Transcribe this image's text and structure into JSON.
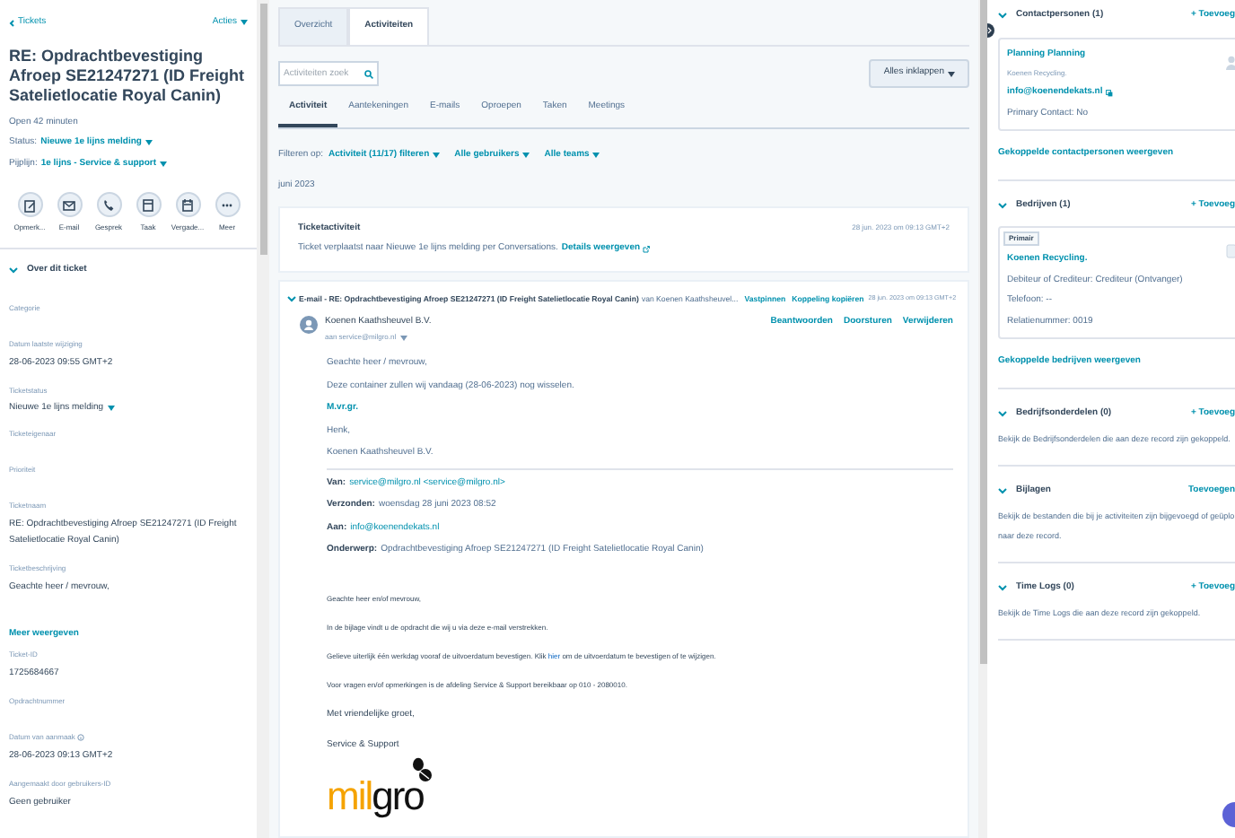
{
  "left": {
    "back_link": "Tickets",
    "actions_menu": "Acties",
    "title": "RE: Opdrachtbevestiging Afroep SE21247271 (ID Freight Satelietlocatie Royal Canin)",
    "open_time": "Open 42 minuten",
    "meta": [
      {
        "label": "Status:",
        "value": "Nieuwe 1e lijns melding"
      },
      {
        "label": "Pijplijn:",
        "value": "1e lijns - Service & support"
      }
    ],
    "quick_actions": [
      {
        "kind": "note",
        "label": "Opmerk..."
      },
      {
        "kind": "email",
        "label": "E-mail"
      },
      {
        "kind": "call",
        "label": "Gesprek"
      },
      {
        "kind": "task",
        "label": "Taak"
      },
      {
        "kind": "meeting",
        "label": "Vergade..."
      },
      {
        "kind": "more",
        "label": "Meer"
      }
    ],
    "section": {
      "title": "Over dit ticket",
      "expanded": true
    },
    "fields": [
      {
        "kind": "field",
        "label": "Categorie"
      },
      {
        "kind": "field",
        "label": "Datum laatste wijziging",
        "value": "28-06-2023 09:55 GMT+2"
      },
      {
        "kind": "dropdown",
        "label": "Ticketstatus",
        "value": "Nieuwe 1e lijns melding"
      },
      {
        "kind": "field",
        "label": "Ticketeigenaar"
      },
      {
        "kind": "field",
        "label": "Prioriteit"
      },
      {
        "kind": "field",
        "label": "Ticketnaam",
        "value": "RE: Opdrachtbevestiging Afroep SE21247271 (ID Freight Satelietlocatie Royal Canin)"
      },
      {
        "kind": "field",
        "label": "Ticketbeschrijving",
        "value": "Geachte heer / mevrouw,"
      },
      {
        "kind": "link",
        "label": "Meer weergeven"
      },
      {
        "kind": "field",
        "label": "Ticket-ID",
        "value": "1725684667"
      },
      {
        "kind": "field",
        "label": "Opdrachtnummer"
      },
      {
        "kind": "info",
        "label": "Datum van aanmaak",
        "value": "28-06-2023 09:13 GMT+2"
      },
      {
        "kind": "field",
        "label": "Aangemaakt door gebruikers-ID",
        "value": "Geen gebruiker"
      }
    ]
  },
  "middle": {
    "tabs": [
      {
        "label": "Overzicht",
        "selected": false
      },
      {
        "label": "Activiteiten",
        "selected": true
      }
    ],
    "search": {
      "placeholder": "Activiteiten zoek"
    },
    "collapse_button": "Alles inklappen",
    "subtabs": [
      {
        "label": "Activiteit",
        "selected": true
      },
      {
        "label": "Aantekeningen",
        "selected": false
      },
      {
        "label": "E-mails",
        "selected": false
      },
      {
        "label": "Oproepen",
        "selected": false
      },
      {
        "label": "Taken",
        "selected": false
      },
      {
        "label": "Meetings",
        "selected": false
      }
    ],
    "filter_label": "Filteren op:",
    "filters": [
      "Activiteit (11/17) filteren",
      "Alle gebruikers",
      "Alle teams"
    ],
    "month": "juni 2023",
    "ticket_activity": {
      "title": "Ticketactiviteit",
      "time": "28 jun. 2023 om 09:13 GMT+2",
      "text": "Ticket verplaatst naar Nieuwe 1e lijns melding per Conversations.",
      "link": "Details weergeven"
    },
    "email": {
      "expanded": true,
      "subject": "E-mail - RE: Opdrachtbevestiging Afroep SE21247271 (ID Freight Satelietlocatie Royal Canin)",
      "from": "van Koenen Kaathsheuvel...",
      "actions": [
        "Vastpinnen",
        "Koppeling kopiëren"
      ],
      "time": "28 jun. 2023 om 09:13 GMT+2",
      "sender": "Koenen Kaathsheuvel B.V.",
      "recipient": "aan service@milgro.nl",
      "reply_actions": [
        "Beantwoorden",
        "Doorsturen",
        "Verwijderen"
      ],
      "body": [
        {
          "kind": "text",
          "text": "Geachte heer / mevrouw,"
        },
        {
          "kind": "text",
          "text": "Deze container zullen wij vandaag (28-06-2023) nog wisselen."
        },
        {
          "kind": "link",
          "text": "M.vr.gr."
        },
        {
          "kind": "text",
          "text": "Henk,"
        },
        {
          "kind": "text",
          "text": "Koenen Kaathsheuvel B.V."
        }
      ],
      "headers": [
        {
          "label": "Van:",
          "value": "service@milgro.nl <service@milgro.nl>",
          "link": true
        },
        {
          "label": "Verzonden:",
          "value": "woensdag 28 juni 2023 08:52",
          "link": false
        },
        {
          "label": "Aan:",
          "value": "info@koenendekats.nl",
          "link": true
        },
        {
          "label": "Onderwerp:",
          "value": "Opdrachtbevestiging Afroep SE21247271 (ID Freight Satelietlocatie Royal Canin)",
          "link": false
        }
      ],
      "quoted": [
        [
          {
            "text": "Geachte heer en/of mevrouw,",
            "link": false
          }
        ],
        [
          {
            "text": "In de bijlage vindt u de opdracht die wij u via deze e-mail verstrekken.",
            "link": false
          }
        ],
        [
          {
            "text": "Gelieve uiterlijk één werkdag vooraf de uitvoerdatum bevestigen. Klik ",
            "link": false
          },
          {
            "text": "hier",
            "link": true
          },
          {
            "text": " om de uitvoerdatum te bevestigen of te wijzigen.",
            "link": false
          }
        ],
        [
          {
            "text": "Voor vragen en/of opmerkingen is de afdeling Service & Support bereikbaar op 010 - 2080010.",
            "link": false
          }
        ]
      ],
      "closing": "Met vriendelijke groet,",
      "signature": "Service & Support",
      "logo": {
        "left": "mil",
        "right": "gro"
      }
    }
  },
  "right": {
    "sections": [
      {
        "kind": "contacts",
        "title": "Contactpersonen (1)",
        "expanded": true,
        "add": "+ Toevoeg",
        "card": {
          "name": "Planning Planning",
          "company": "Koenen Recycling.",
          "email": "info@koenendekats.nl",
          "detail": "Primary Contact: No"
        },
        "link": "Gekoppelde contactpersonen weergeven"
      },
      {
        "kind": "companies",
        "title": "Bedrijven (1)",
        "expanded": true,
        "add": "+ Toevoeg",
        "card": {
          "tag": "Primair",
          "name": "Koenen Recycling.",
          "lines": [
            "Debiteur of Crediteur: Crediteur (Ontvanger)",
            "Telefoon: --",
            "Relatienummer: 0019"
          ]
        },
        "link": "Gekoppelde bedrijven weergeven"
      },
      {
        "kind": "text",
        "title": "Bedrijfsonderdelen (0)",
        "expanded": true,
        "add": "+ Toevoeg",
        "lines": [
          "Bekijk de Bedrijfsonderdelen die aan deze record zijn gekoppeld."
        ]
      },
      {
        "kind": "text",
        "title": "Bijlagen",
        "expanded": true,
        "add": "Toevoegen",
        "lines": [
          "Bekijk de bestanden die bij je activiteiten zijn bijgevoegd of geüplo",
          "naar deze record."
        ]
      },
      {
        "kind": "text",
        "title": "Time Logs (0)",
        "expanded": true,
        "add": "+ Toevoeg",
        "lines": [
          "Bekijk de Time Logs die aan deze record zijn gekoppeld."
        ]
      }
    ]
  }
}
